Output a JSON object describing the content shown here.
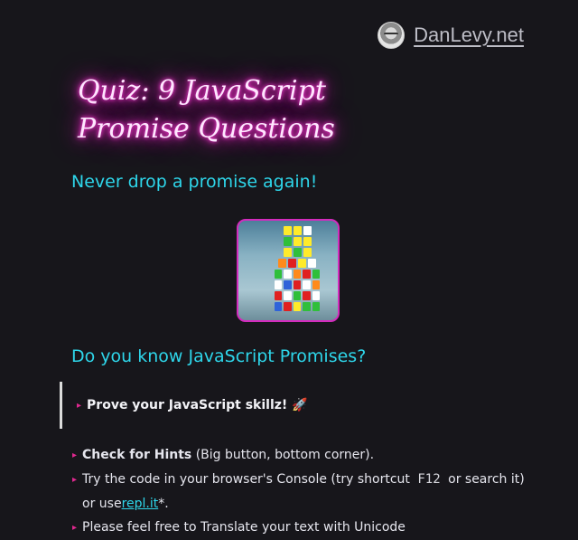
{
  "header": {
    "site_name": "DanLevy.net"
  },
  "article": {
    "title": "Quiz: 9 JavaScript Promise Questions",
    "subtitle": "Never drop a promise again!",
    "section_heading": "Do you know JavaScript Promises?",
    "blockquote": {
      "text": "Prove your JavaScript skillz! 🚀"
    },
    "list": {
      "item1_bold": "Check for Hints",
      "item1_rest": " (Big button, bottom corner).",
      "item2_a": "Try the code in your browser's Console (try shortcut ",
      "item2_kbd": "F12",
      "item2_b": " or search it)",
      "item2_c": "or use ",
      "item2_link": "repl.it",
      "item2_d": "*.",
      "item3_partial": "Please feel free to Translate your text with Unicode"
    }
  },
  "colors": {
    "accent": "#2ed6ea",
    "neon": "#ff2fd0",
    "bullet": "#e0288f",
    "background": "#17161b"
  },
  "hero_image": {
    "alt": "Rubik's cube tower"
  }
}
